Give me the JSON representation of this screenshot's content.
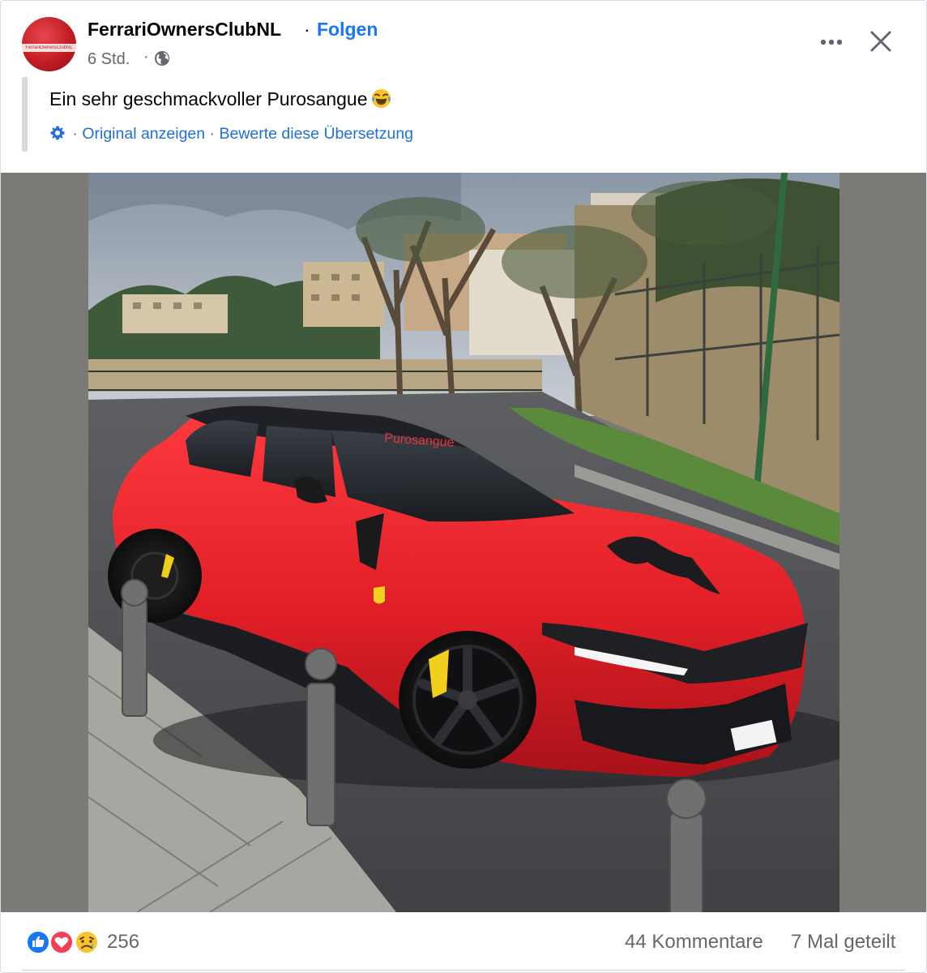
{
  "post": {
    "page_name": "FerrariOwnersClubNL",
    "separator": "·",
    "follow_label": "Folgen",
    "time": "6 Std.",
    "time_separator": "·",
    "audience_icon": "globe-icon",
    "avatar_text": "FerrariOwnersClubNL",
    "menu_icon": "more-horizontal-icon",
    "close_icon": "close-icon",
    "text": "Ein sehr geschmackvoller Purosangue",
    "text_emoji": "face-with-tears-of-joy-icon",
    "translation": {
      "icon": "gear-icon",
      "dot1": "·",
      "show_original": "Original anzeigen",
      "dot2": "·",
      "rate_translation": "Bewerte diese Übersetzung"
    },
    "image": {
      "windshield_text": "Purosangue",
      "plate_text": ""
    }
  },
  "footer": {
    "reaction_icons": [
      "like-icon",
      "love-icon",
      "sad-icon"
    ],
    "reaction_count": "256",
    "comments": "44 Kommentare",
    "shares": "7 Mal geteilt"
  },
  "colors": {
    "link": "#216fdb",
    "follow": "#1877f2",
    "secondary_text": "#65676b",
    "car_red": "#e11f27"
  }
}
